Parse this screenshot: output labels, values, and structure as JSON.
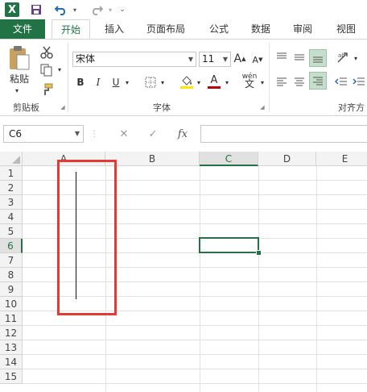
{
  "qat": {
    "app_icon": "X",
    "save_icon": "save-icon",
    "undo_icon": "undo-icon",
    "redo_icon": "redo-icon",
    "customize_icon": "customize-icon"
  },
  "tabs": [
    "文件",
    "开始",
    "插入",
    "页面布局",
    "公式",
    "数据",
    "审阅",
    "视图"
  ],
  "active_tab": "开始",
  "clipboard": {
    "paste_label": "粘贴",
    "group_label": "剪贴板"
  },
  "font": {
    "name": "宋体",
    "size": "11",
    "bold": "B",
    "italic": "I",
    "underline": "U",
    "grow": "A",
    "shrink": "A",
    "phonetic": "wén",
    "group_label": "字体"
  },
  "alignment": {
    "group_label": "对齐方"
  },
  "formula_bar": {
    "cell_ref": "C6",
    "fx": "fx"
  },
  "columns": [
    "A",
    "B",
    "C",
    "D",
    "E"
  ],
  "selected_column": "C",
  "rows": [
    "1",
    "2",
    "3",
    "4",
    "5",
    "6",
    "7",
    "8",
    "9",
    "10",
    "11",
    "12",
    "13",
    "14",
    "15"
  ],
  "selected_row": "6",
  "colors": {
    "accent": "#217346",
    "highlight_box": "#e53935",
    "fill_yellow": "#ffe600",
    "font_red": "#c00000"
  }
}
